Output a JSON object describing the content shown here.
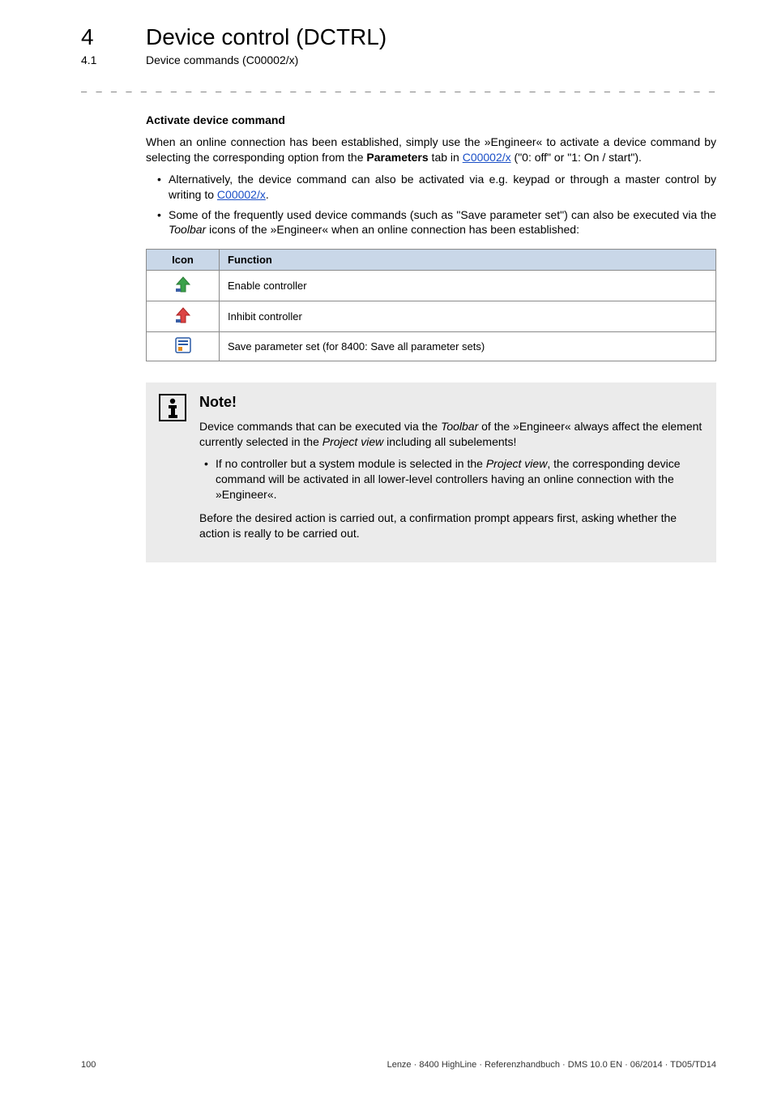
{
  "header": {
    "chapter_number": "4",
    "chapter_title": "Device control (DCTRL)",
    "section_number": "4.1",
    "section_title": "Device commands (C00002/x)"
  },
  "dashline": "_ _ _ _ _ _ _ _ _ _ _ _ _ _ _ _ _ _ _ _ _ _ _ _ _ _ _ _ _ _ _ _ _ _ _ _ _ _ _ _ _ _ _ _ _ _ _ _ _ _ _ _ _ _ _ _ _ _ _ _ _ _ _ _",
  "section_heading": "Activate device command",
  "intro": {
    "pre": "When an online connection has been established, simply use the »Engineer« to activate a device command by selecting the corresponding option from the ",
    "bold1": "Parameters",
    "mid": " tab in ",
    "link1": "C00002/x",
    "post": " (\"0: off\" or \"1: On / start\")."
  },
  "bullets": [
    {
      "pre": "Alternatively, the device command can also be activated via e.g. keypad or through a master control by writing to ",
      "link": "C00002/x",
      "post": "."
    },
    {
      "pre": "Some of the frequently used device commands (such as \"Save parameter set\") can also be executed via the ",
      "italic": "Toolbar",
      "post": " icons of the »Engineer« when an online connection has been established:"
    }
  ],
  "table": {
    "headers": {
      "icon": "Icon",
      "function": "Function"
    },
    "rows": [
      {
        "icon": "enable-controller-icon",
        "function": "Enable controller"
      },
      {
        "icon": "inhibit-controller-icon",
        "function": "Inhibit controller"
      },
      {
        "icon": "save-parameter-icon",
        "function": "Save parameter set (for 8400: Save all parameter sets)"
      }
    ]
  },
  "note": {
    "title": "Note!",
    "p1": {
      "pre": "Device commands that can be executed via the ",
      "i1": "Toolbar",
      "mid": " of the »Engineer« always affect the element currently selected in the ",
      "i2": "Project view",
      "post": " including all subelements!"
    },
    "li1": {
      "pre": "If no controller but a system module is selected in the ",
      "i1": "Project view",
      "post": ", the corresponding device command will be activated in all lower-level controllers having an online connection with the »Engineer«."
    },
    "p2": "Before the desired action is carried out, a confirmation prompt appears first, asking whether the action is really to be carried out."
  },
  "footer": {
    "page": "100",
    "right": "Lenze · 8400 HighLine · Referenzhandbuch · DMS 10.0 EN · 06/2014 · TD05/TD14"
  }
}
